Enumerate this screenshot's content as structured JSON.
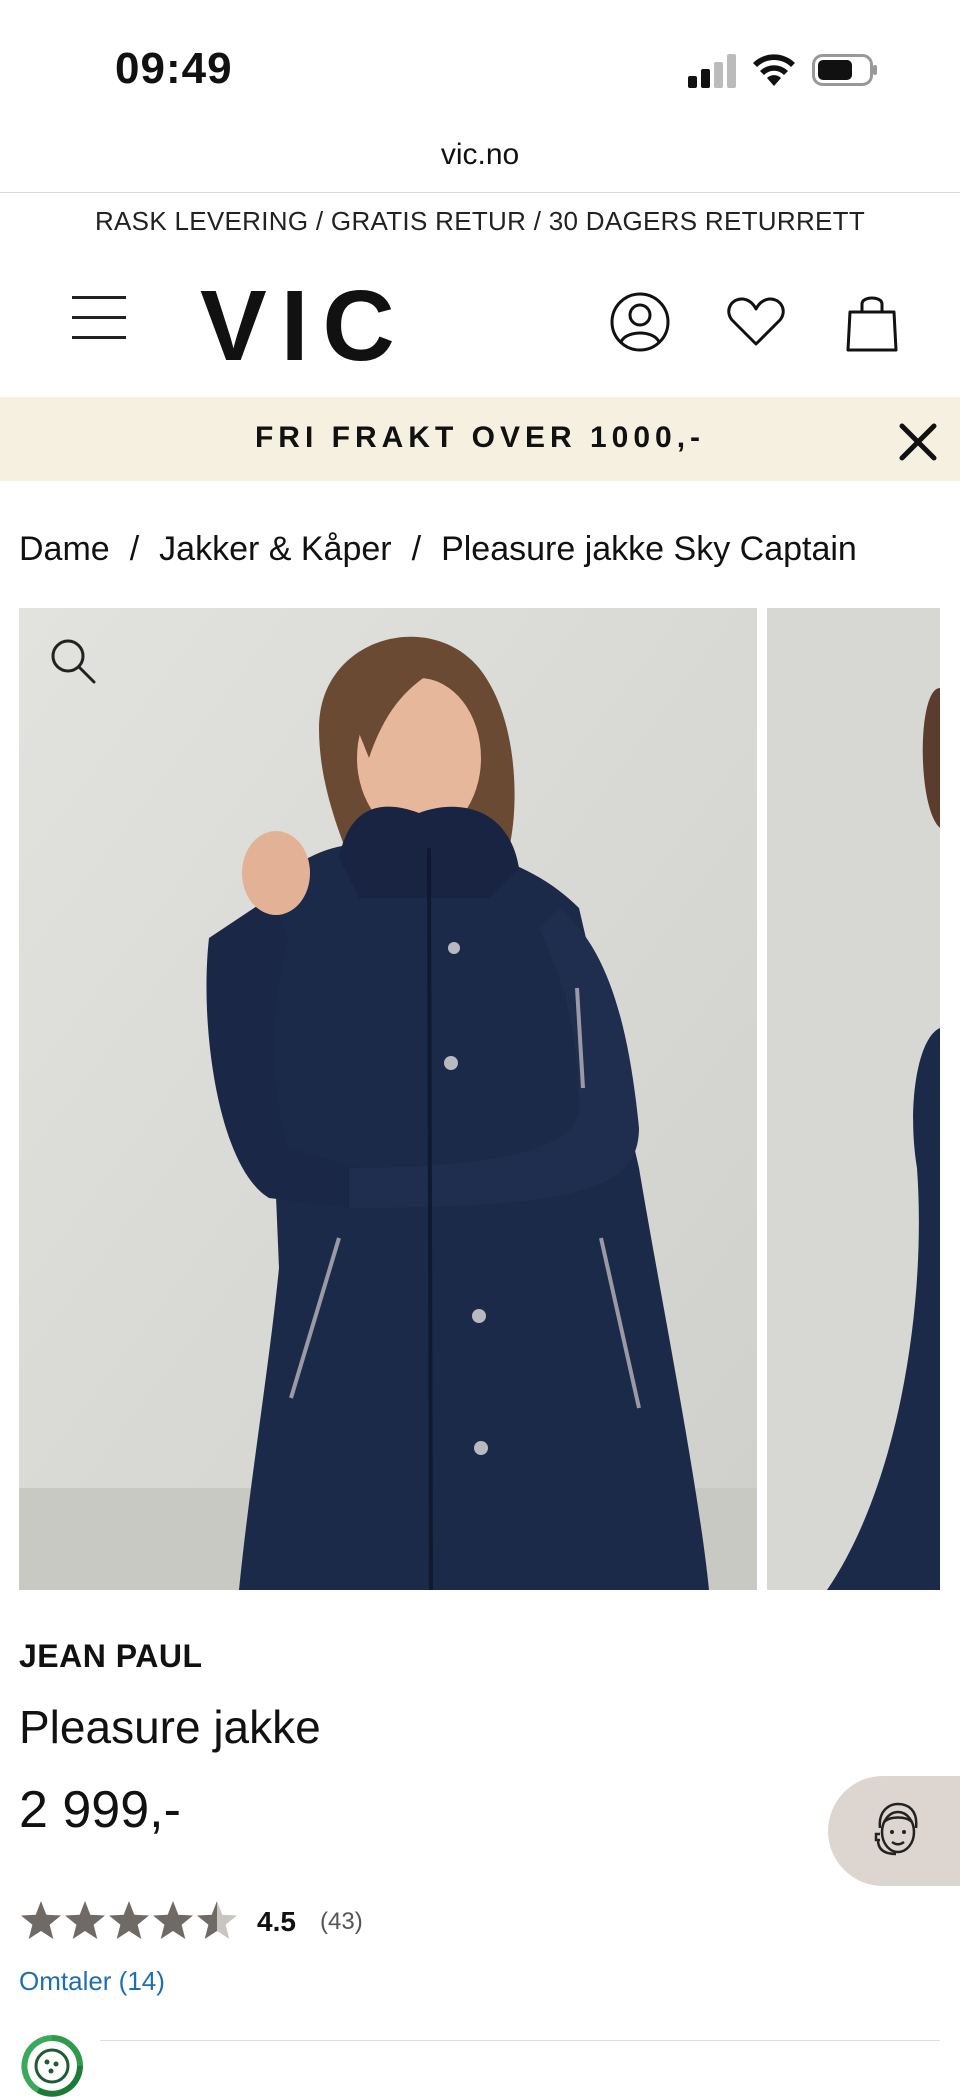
{
  "status_bar": {
    "time": "09:49"
  },
  "browser": {
    "url": "vic.no"
  },
  "usp_line": "RASK LEVERING / GRATIS RETUR / 30 DAGERS RETURRETT",
  "header": {
    "logo": "VIC",
    "icons": [
      "menu-icon",
      "account-icon",
      "heart-icon",
      "bag-icon"
    ]
  },
  "banner": {
    "text": "FRI FRAKT OVER 1000,-",
    "background": "#f6f0e1"
  },
  "breadcrumb": [
    {
      "label": "Dame"
    },
    {
      "label": "Jakker & Kåper"
    },
    {
      "label": "Pleasure jakke Sky Captain"
    }
  ],
  "product": {
    "brand": "JEAN PAUL",
    "name": "Pleasure jakke",
    "price": "2 999,-",
    "rating": "4.5",
    "rating_value": 4.5,
    "rating_max": 5,
    "review_count": "(43)",
    "qa_link": "Omtaler (14)",
    "jacket_color": "#1c2a4a"
  },
  "colors": {
    "link": "#1f6fb0",
    "star": "#6f6a66"
  }
}
